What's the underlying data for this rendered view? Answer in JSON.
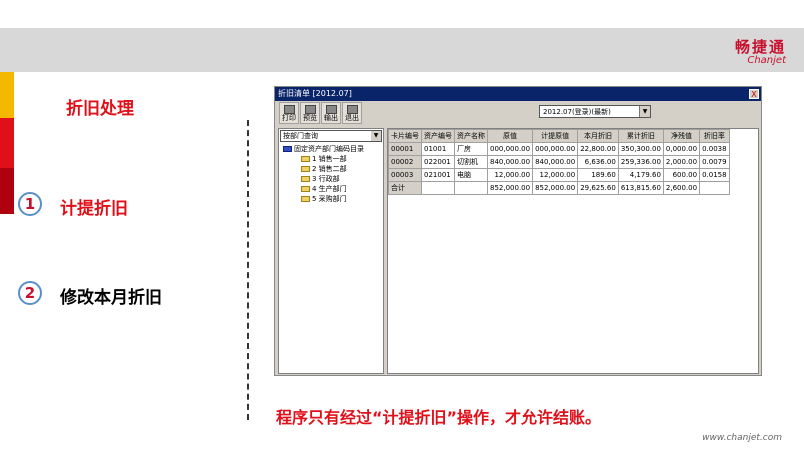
{
  "brand": {
    "cn": "畅捷通",
    "en": "Chanjet",
    "url": "www.chanjet.com",
    "color": "#c8102e"
  },
  "slide": {
    "title": "折旧处理",
    "items": [
      {
        "num": "1",
        "label": "计提折旧",
        "color": "#e0101a"
      },
      {
        "num": "2",
        "label": "修改本月折旧",
        "color": "#000000"
      }
    ],
    "footer_note": "程序只有经过“计提折旧”操作，才允许结账。"
  },
  "window": {
    "title": "折旧清单 [2012.07]",
    "close": "X",
    "toolbar": [
      {
        "label": "打印",
        "icon": "printer-icon"
      },
      {
        "label": "预览",
        "icon": "preview-icon"
      },
      {
        "label": "输出",
        "icon": "export-icon"
      },
      {
        "label": "退出",
        "icon": "exit-icon"
      }
    ],
    "period_select": "2012.07(登录)(最新)",
    "dept_select": "按部门查询",
    "tree": {
      "root": "固定资产部门编码目录",
      "children": [
        "1 销售一部",
        "2 销售二部",
        "3 行政部",
        "4 生产部门",
        "5 采购部门"
      ]
    },
    "table": {
      "columns": [
        "卡片编号",
        "资产编号",
        "资产名称",
        "原值",
        "计提原值",
        "本月折旧",
        "累计折旧",
        "净残值",
        "折旧率"
      ],
      "rows": [
        [
          "00001",
          "01001",
          "厂房",
          "000,000.00",
          "000,000.00",
          "22,800.00",
          "350,300.00",
          "0,000.00",
          "0.0038"
        ],
        [
          "00002",
          "022001",
          "切割机",
          "840,000.00",
          "840,000.00",
          "6,636.00",
          "259,336.00",
          "2,000.00",
          "0.0079"
        ],
        [
          "00003",
          "021001",
          "电脑",
          "12,000.00",
          "12,000.00",
          "189.60",
          "4,179.60",
          "600.00",
          "0.0158"
        ],
        [
          "合计",
          "",
          "",
          "852,000.00",
          "852,000.00",
          "29,625.60",
          "613,815.60",
          "2,600.00",
          ""
        ]
      ]
    }
  }
}
